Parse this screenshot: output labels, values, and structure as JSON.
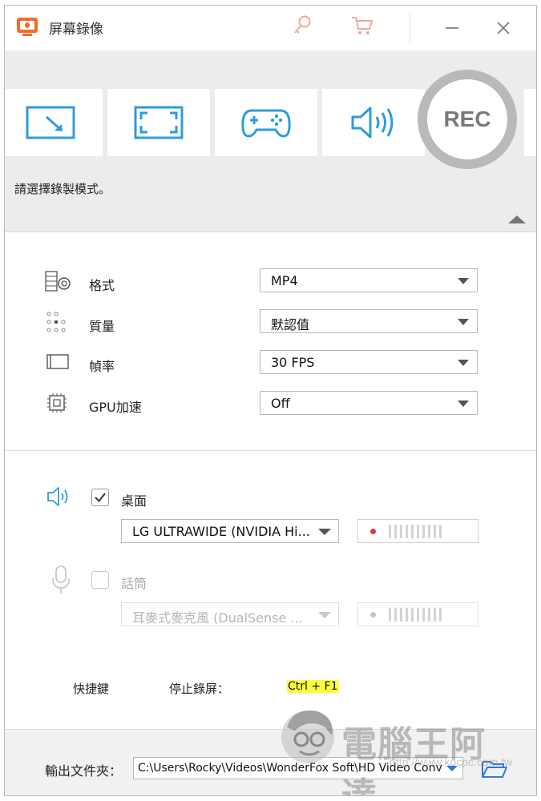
{
  "app": {
    "title": "屏幕錄像"
  },
  "window": {
    "minimize_icon": "minimize-icon",
    "close_icon": "close-icon",
    "key_icon": "key-icon",
    "cart_icon": "cart-icon"
  },
  "modes": {
    "items": [
      {
        "icon": "region-capture-icon"
      },
      {
        "icon": "fullscreen-capture-icon"
      },
      {
        "icon": "game-capture-icon"
      },
      {
        "icon": "audio-capture-icon"
      }
    ],
    "rec_label": "REC",
    "hint": "請選擇錄製模式。"
  },
  "settings": {
    "rows": [
      {
        "label": "格式",
        "value": "MP4",
        "icon": "format-icon"
      },
      {
        "label": "質量",
        "value": "默認值",
        "icon": "quality-icon"
      },
      {
        "label": "幀率",
        "value": "30 FPS",
        "icon": "framerate-icon"
      },
      {
        "label": "GPU加速",
        "value": "Off",
        "icon": "gpu-icon"
      }
    ]
  },
  "audio": {
    "desktop": {
      "label": "桌面",
      "checked": true,
      "device": "LG ULTRAWIDE (NVIDIA Hi...",
      "icon": "speaker-icon"
    },
    "mic": {
      "label": "話筒",
      "checked": false,
      "device": "耳麥式麥克風 (DualSense ...",
      "icon": "microphone-icon"
    }
  },
  "hotkey": {
    "section_label": "快捷鍵",
    "action": "停止錄屏：",
    "keys": "Ctrl + F1"
  },
  "output": {
    "label": "輸出文件夾：",
    "path": "C:\\Users\\Rocky\\Videos\\WonderFox Soft\\HD Video Conv",
    "icon": "folder-open-icon"
  },
  "watermark": {
    "text": "電腦王阿達",
    "url": "http://www.kocpc.com.tw"
  },
  "colors": {
    "accent": "#2d9cdb",
    "brand": "#f26b2b",
    "rec_ring": "#b9b9b9"
  }
}
